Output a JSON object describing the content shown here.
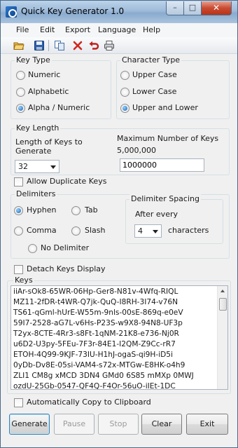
{
  "window": {
    "title": "Quick Key Generator 1.0",
    "min_glyph": "–",
    "max_glyph": "□",
    "close_glyph": "✕"
  },
  "menu": [
    "File",
    "Edit",
    "Export",
    "Language",
    "Help"
  ],
  "toolbar_icons": [
    "open-folder-icon",
    "save-icon",
    "copy-icon",
    "delete-icon",
    "undo-icon",
    "print-icon"
  ],
  "key_type": {
    "legend": "Key Type",
    "options": [
      "Numeric",
      "Alphabetic",
      "Alpha / Numeric"
    ],
    "selected": "Alpha / Numeric"
  },
  "character_type": {
    "legend": "Character Type",
    "options": [
      "Upper Case",
      "Lower Case",
      "Upper and Lower"
    ],
    "selected": "Upper and Lower"
  },
  "key_length": {
    "legend": "Key Length",
    "length_label": "Length of Keys to Generate",
    "length_value": "32",
    "max_label": "Maximum Number of Keys",
    "max_value": "5,000,000",
    "count_value": "1000000"
  },
  "allow_duplicates": {
    "label": "Allow Duplicate Keys",
    "checked": false
  },
  "delimiters": {
    "legend": "Delimiters",
    "options": [
      "Hyphen",
      "Tab",
      "Comma",
      "Slash",
      "No Delimiter"
    ],
    "selected": "Hyphen",
    "spacing_legend": "Delimiter Spacing",
    "after_every": "After every",
    "spacing_value": "4",
    "characters": "characters"
  },
  "detach": {
    "label": "Detach Keys Display",
    "checked": false
  },
  "keys": {
    "legend": "Keys",
    "lines": [
      "iiAr-sOk8-65WR-06Hp-Ger8-N81v-4Wfq-RIQL",
      "MZ11-2fDR-t4WR-Q7jk-QuQ-I8RH-3I74-v76N",
      "TS61-qGml-hUrE-W55m-9nls-00sE-869q-e0eV",
      "59I7-2528-aG7L-v6Hs-P23S-w9X8-94N8-UF3p",
      "T2yx-8CTE-4Rr3-s8Ft-1qNM-21K8-e736-Nj0R",
      "u6D2-U3py-5FEu-7F3r-84E1-I2QM-Z9Cc-rR7",
      "ETOH-4Q99-9KJF-73IU-H1hJ-ogaS-qi9H-iD5i",
      "0yDb-Dv8E-05si-VAM4-s72x-MTGw-E8HK-o4h9",
      "ZLI1 CM8g xMCD 3DN4 GMd0 6S85 mMXp 0MWJ",
      "ozdU-25Gb-0547-QF4Q-F4Or-56uO-iIEt-1DC"
    ]
  },
  "auto_copy": {
    "label": "Automatically Copy to Clipboard",
    "checked": false
  },
  "buttons": {
    "generate": "Generate",
    "pause": "Pause",
    "stop": "Stop",
    "clear": "Clear",
    "exit": "Exit"
  }
}
